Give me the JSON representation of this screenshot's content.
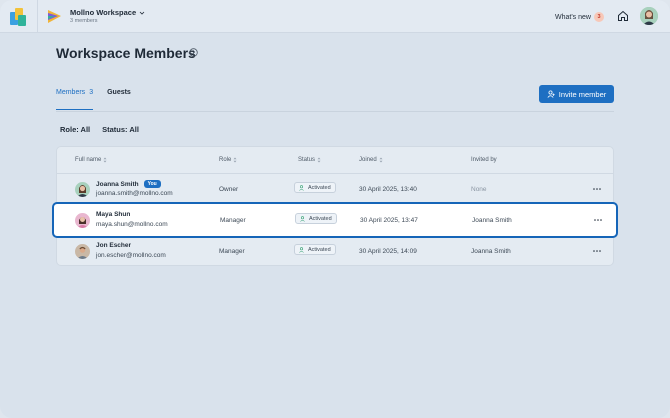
{
  "topbar": {
    "workspace_name": "Mollno Workspace",
    "workspace_members": "3 members",
    "whats_new_label": "What's new",
    "whats_new_count": "3"
  },
  "page": {
    "title": "Workspace Members"
  },
  "tabs": [
    {
      "label": "Members",
      "count": "3"
    },
    {
      "label": "Guests"
    }
  ],
  "invite_button": "Invite member",
  "filters": {
    "role": "Role: All",
    "status": "Status: All"
  },
  "table": {
    "headers": [
      "Full name",
      "Role",
      "Status",
      "Joined",
      "Invited by"
    ],
    "rows": [
      {
        "name": "Joanna Smith",
        "badge": "You",
        "email": "joanna.smith@mollno.com",
        "role": "Owner",
        "status": "Activated",
        "joined": "30 April 2025, 13:40",
        "invited_by": "None"
      },
      {
        "name": "Maya Shun",
        "email": "maya.shun@mollno.com",
        "role": "Manager",
        "status": "Activated",
        "joined": "30 April 2025, 13:47",
        "invited_by": "Joanna Smith"
      },
      {
        "name": "Jon Escher",
        "email": "jon.escher@mollno.com",
        "role": "Manager",
        "status": "Activated",
        "joined": "30 April 2025, 14:09",
        "invited_by": "Joanna Smith"
      }
    ]
  },
  "colors": {
    "accent": "#1e6fc2",
    "background": "#d9e2ec"
  }
}
